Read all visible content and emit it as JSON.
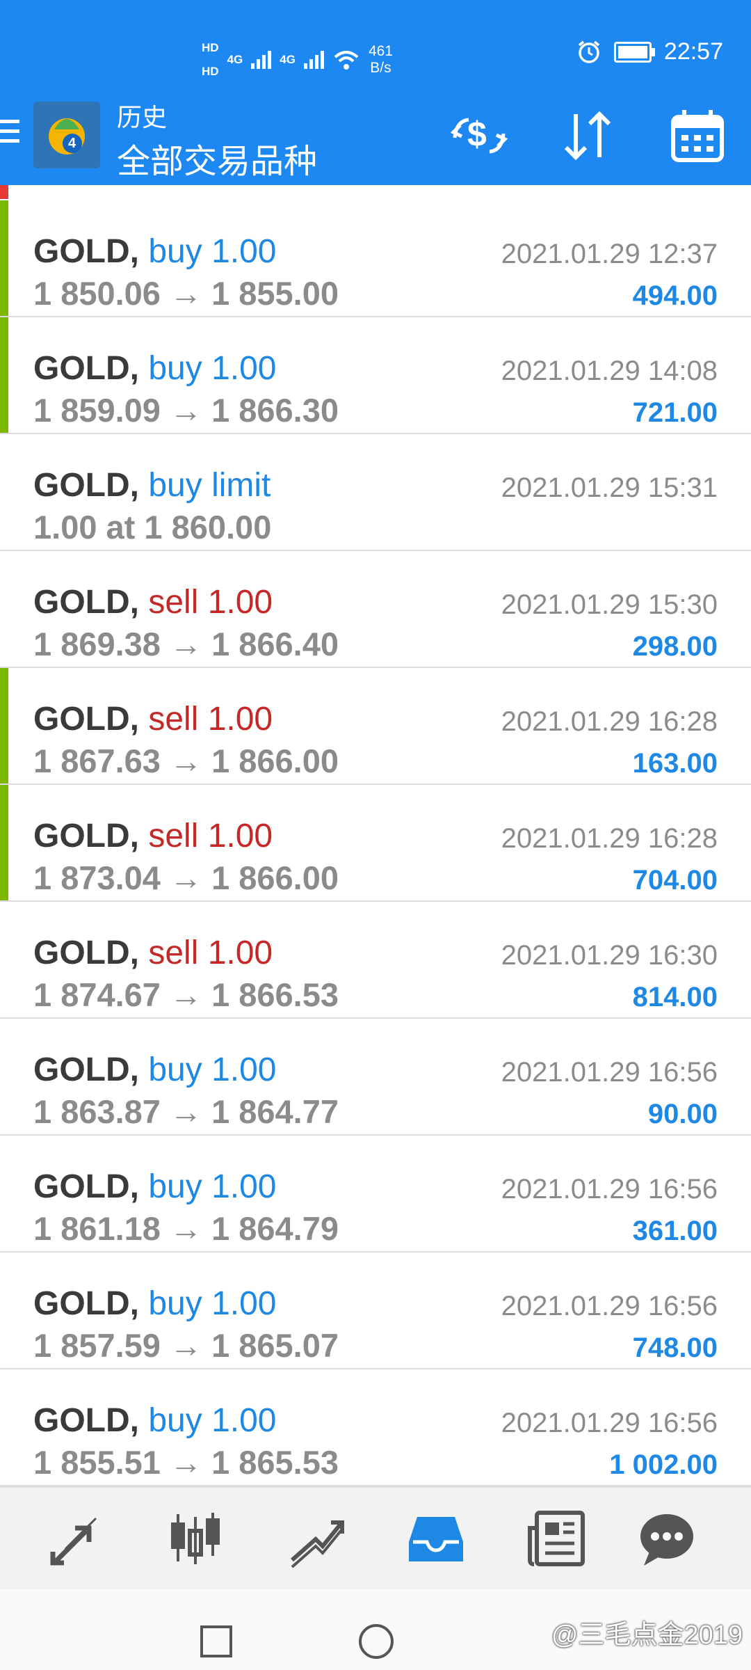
{
  "status_bar": {
    "hd1": "HD",
    "hd2": "HD",
    "net1": "4G",
    "net2": "4G",
    "speed_value": "461",
    "speed_unit": "B/s",
    "time": "22:57"
  },
  "header": {
    "title": "历史",
    "subtitle": "全部交易品种"
  },
  "trades": [
    {
      "symbol": "GOLD,",
      "side": "buy",
      "label": "buy 1.00",
      "prices": "1 850.06 → 1 855.00",
      "time": "2021.01.29 12:37",
      "profit": "494.00",
      "bar": true
    },
    {
      "symbol": "GOLD,",
      "side": "buy",
      "label": "buy 1.00",
      "prices": "1 859.09 → 1 866.30",
      "time": "2021.01.29 14:08",
      "profit": "721.00",
      "bar": true
    },
    {
      "symbol": "GOLD,",
      "side": "buy",
      "label": "buy limit",
      "prices": "1.00 at 1 860.00",
      "time": "2021.01.29 15:31",
      "profit": "",
      "bar": false
    },
    {
      "symbol": "GOLD,",
      "side": "sell",
      "label": "sell 1.00",
      "prices": "1 869.38 → 1 866.40",
      "time": "2021.01.29 15:30",
      "profit": "298.00",
      "bar": false
    },
    {
      "symbol": "GOLD,",
      "side": "sell",
      "label": "sell 1.00",
      "prices": "1 867.63 → 1 866.00",
      "time": "2021.01.29 16:28",
      "profit": "163.00",
      "bar": true
    },
    {
      "symbol": "GOLD,",
      "side": "sell",
      "label": "sell 1.00",
      "prices": "1 873.04 → 1 866.00",
      "time": "2021.01.29 16:28",
      "profit": "704.00",
      "bar": true
    },
    {
      "symbol": "GOLD,",
      "side": "sell",
      "label": "sell 1.00",
      "prices": "1 874.67 → 1 866.53",
      "time": "2021.01.29 16:30",
      "profit": "814.00",
      "bar": false
    },
    {
      "symbol": "GOLD,",
      "side": "buy",
      "label": "buy 1.00",
      "prices": "1 863.87 → 1 864.77",
      "time": "2021.01.29 16:56",
      "profit": "90.00",
      "bar": false
    },
    {
      "symbol": "GOLD,",
      "side": "buy",
      "label": "buy 1.00",
      "prices": "1 861.18 → 1 864.79",
      "time": "2021.01.29 16:56",
      "profit": "361.00",
      "bar": false
    },
    {
      "symbol": "GOLD,",
      "side": "buy",
      "label": "buy 1.00",
      "prices": "1 857.59 → 1 865.07",
      "time": "2021.01.29 16:56",
      "profit": "748.00",
      "bar": false
    },
    {
      "symbol": "GOLD,",
      "side": "buy",
      "label": "buy 1.00",
      "prices": "1 855.51 → 1 865.53",
      "time": "2021.01.29 16:56",
      "profit": "1 002.00",
      "bar": false
    }
  ],
  "toolbar_icons": [
    "swap-currency-icon",
    "sort-icon",
    "calendar-icon"
  ],
  "bottom_nav": [
    {
      "icon": "quotes-arrows-icon",
      "active": false
    },
    {
      "icon": "chart-candles-icon",
      "active": false
    },
    {
      "icon": "trade-lines-icon",
      "active": false
    },
    {
      "icon": "history-inbox-icon",
      "active": true
    },
    {
      "icon": "news-icon",
      "active": false
    },
    {
      "icon": "chat-icon",
      "active": false
    }
  ],
  "watermark": "@三毛点金2019",
  "colors": {
    "accent": "#1E88F2",
    "buy": "#1E88E5",
    "sell": "#C62828",
    "closed_bar": "#7CB800",
    "text_dark": "#3A3A3A",
    "text_muted": "#8B8B8B"
  }
}
